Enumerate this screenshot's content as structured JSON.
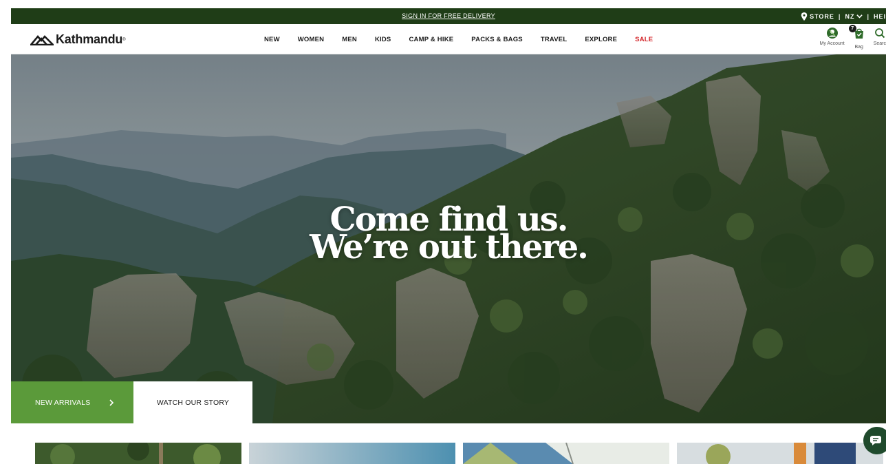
{
  "topbar": {
    "promo": "SIGN IN FOR FREE DELIVERY",
    "store_label": "STORE",
    "region_label": "NZ",
    "help_label": "HEI",
    "separator": "|",
    "bg_color": "#1f3d17"
  },
  "header": {
    "logo_text": "Kathmandu",
    "logo_reg": "®",
    "nav": [
      {
        "label": "NEW"
      },
      {
        "label": "WOMEN"
      },
      {
        "label": "MEN"
      },
      {
        "label": "KIDS"
      },
      {
        "label": "CAMP & HIKE"
      },
      {
        "label": "PACKS & BAGS"
      },
      {
        "label": "TRAVEL"
      },
      {
        "label": "EXPLORE"
      },
      {
        "label": "SALE"
      }
    ],
    "account_label": "My Account",
    "bag_label": "Bag",
    "bag_count": "7",
    "search_label": "Searc",
    "sale_color": "#d4262b"
  },
  "hero": {
    "title_line1": "Come find us.",
    "title_line2": "We’re out there.",
    "cta_primary": "NEW ARRIVALS",
    "cta_secondary": "WATCH OUR STORY",
    "accent_color": "#5b9a3a"
  },
  "icons": {
    "store": "pin-icon",
    "region": "chevron-down-icon",
    "account": "user-circle-icon",
    "bag": "bag-icon",
    "search": "search-icon",
    "cta": "chevron-right-icon",
    "chat": "chat-icon"
  }
}
